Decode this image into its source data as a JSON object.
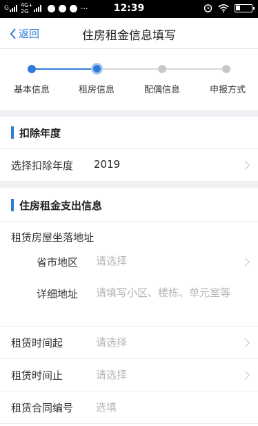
{
  "status_bar": {
    "carrier1": "G",
    "net_top": "4G+",
    "net_bottom": "2G",
    "more": "···",
    "time": "12:39"
  },
  "nav": {
    "back_label": "返回",
    "title": "住房租金信息填写"
  },
  "stepper": {
    "active_color": "#2f7bd6",
    "inactive_color": "#c8c8c8",
    "current_step": 2,
    "steps": [
      {
        "label": "基本信息"
      },
      {
        "label": "租房信息"
      },
      {
        "label": "配偶信息"
      },
      {
        "label": "申报方式"
      }
    ]
  },
  "deduction_year": {
    "section_title": "扣除年度",
    "label": "选择扣除年度",
    "value": "2019"
  },
  "rent_expense": {
    "section_title": "住房租金支出信息",
    "address_label": "租赁房屋坐落地址",
    "region_label": "省市地区",
    "region_placeholder": "请选择",
    "detail_label": "详细地址",
    "detail_placeholder": "请填写小区、楼栋、单元室等",
    "start_label": "租赁时间起",
    "start_placeholder": "请选择",
    "end_label": "租赁时间止",
    "end_placeholder": "请选择",
    "contract_label": "租赁合同编号",
    "contract_placeholder": "选填"
  }
}
